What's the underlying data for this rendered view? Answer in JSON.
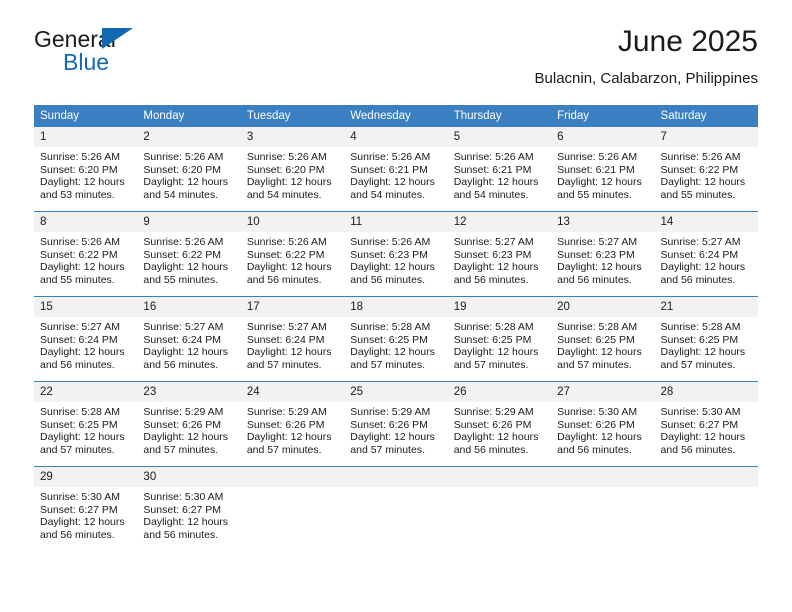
{
  "brand": {
    "name_top": "General",
    "name_bottom": "Blue",
    "triangle_icon": "triangle-icon",
    "colors": {
      "blue": "#1268b3",
      "dark": "#1b1b1b"
    }
  },
  "header": {
    "title": "June 2025",
    "subtitle": "Bulacnin, Calabarzon, Philippines"
  },
  "calendar": {
    "header_bg": "#3a7fc1",
    "daynum_bg": "#f2f2f2",
    "weekdays": [
      "Sunday",
      "Monday",
      "Tuesday",
      "Wednesday",
      "Thursday",
      "Friday",
      "Saturday"
    ],
    "weeks": [
      [
        {
          "day": "1",
          "sunrise": "Sunrise: 5:26 AM",
          "sunset": "Sunset: 6:20 PM",
          "daylight_line1": "Daylight: 12 hours",
          "daylight_line2": "and 53 minutes."
        },
        {
          "day": "2",
          "sunrise": "Sunrise: 5:26 AM",
          "sunset": "Sunset: 6:20 PM",
          "daylight_line1": "Daylight: 12 hours",
          "daylight_line2": "and 54 minutes."
        },
        {
          "day": "3",
          "sunrise": "Sunrise: 5:26 AM",
          "sunset": "Sunset: 6:20 PM",
          "daylight_line1": "Daylight: 12 hours",
          "daylight_line2": "and 54 minutes."
        },
        {
          "day": "4",
          "sunrise": "Sunrise: 5:26 AM",
          "sunset": "Sunset: 6:21 PM",
          "daylight_line1": "Daylight: 12 hours",
          "daylight_line2": "and 54 minutes."
        },
        {
          "day": "5",
          "sunrise": "Sunrise: 5:26 AM",
          "sunset": "Sunset: 6:21 PM",
          "daylight_line1": "Daylight: 12 hours",
          "daylight_line2": "and 54 minutes."
        },
        {
          "day": "6",
          "sunrise": "Sunrise: 5:26 AM",
          "sunset": "Sunset: 6:21 PM",
          "daylight_line1": "Daylight: 12 hours",
          "daylight_line2": "and 55 minutes."
        },
        {
          "day": "7",
          "sunrise": "Sunrise: 5:26 AM",
          "sunset": "Sunset: 6:22 PM",
          "daylight_line1": "Daylight: 12 hours",
          "daylight_line2": "and 55 minutes."
        }
      ],
      [
        {
          "day": "8",
          "sunrise": "Sunrise: 5:26 AM",
          "sunset": "Sunset: 6:22 PM",
          "daylight_line1": "Daylight: 12 hours",
          "daylight_line2": "and 55 minutes."
        },
        {
          "day": "9",
          "sunrise": "Sunrise: 5:26 AM",
          "sunset": "Sunset: 6:22 PM",
          "daylight_line1": "Daylight: 12 hours",
          "daylight_line2": "and 55 minutes."
        },
        {
          "day": "10",
          "sunrise": "Sunrise: 5:26 AM",
          "sunset": "Sunset: 6:22 PM",
          "daylight_line1": "Daylight: 12 hours",
          "daylight_line2": "and 56 minutes."
        },
        {
          "day": "11",
          "sunrise": "Sunrise: 5:26 AM",
          "sunset": "Sunset: 6:23 PM",
          "daylight_line1": "Daylight: 12 hours",
          "daylight_line2": "and 56 minutes."
        },
        {
          "day": "12",
          "sunrise": "Sunrise: 5:27 AM",
          "sunset": "Sunset: 6:23 PM",
          "daylight_line1": "Daylight: 12 hours",
          "daylight_line2": "and 56 minutes."
        },
        {
          "day": "13",
          "sunrise": "Sunrise: 5:27 AM",
          "sunset": "Sunset: 6:23 PM",
          "daylight_line1": "Daylight: 12 hours",
          "daylight_line2": "and 56 minutes."
        },
        {
          "day": "14",
          "sunrise": "Sunrise: 5:27 AM",
          "sunset": "Sunset: 6:24 PM",
          "daylight_line1": "Daylight: 12 hours",
          "daylight_line2": "and 56 minutes."
        }
      ],
      [
        {
          "day": "15",
          "sunrise": "Sunrise: 5:27 AM",
          "sunset": "Sunset: 6:24 PM",
          "daylight_line1": "Daylight: 12 hours",
          "daylight_line2": "and 56 minutes."
        },
        {
          "day": "16",
          "sunrise": "Sunrise: 5:27 AM",
          "sunset": "Sunset: 6:24 PM",
          "daylight_line1": "Daylight: 12 hours",
          "daylight_line2": "and 56 minutes."
        },
        {
          "day": "17",
          "sunrise": "Sunrise: 5:27 AM",
          "sunset": "Sunset: 6:24 PM",
          "daylight_line1": "Daylight: 12 hours",
          "daylight_line2": "and 57 minutes."
        },
        {
          "day": "18",
          "sunrise": "Sunrise: 5:28 AM",
          "sunset": "Sunset: 6:25 PM",
          "daylight_line1": "Daylight: 12 hours",
          "daylight_line2": "and 57 minutes."
        },
        {
          "day": "19",
          "sunrise": "Sunrise: 5:28 AM",
          "sunset": "Sunset: 6:25 PM",
          "daylight_line1": "Daylight: 12 hours",
          "daylight_line2": "and 57 minutes."
        },
        {
          "day": "20",
          "sunrise": "Sunrise: 5:28 AM",
          "sunset": "Sunset: 6:25 PM",
          "daylight_line1": "Daylight: 12 hours",
          "daylight_line2": "and 57 minutes."
        },
        {
          "day": "21",
          "sunrise": "Sunrise: 5:28 AM",
          "sunset": "Sunset: 6:25 PM",
          "daylight_line1": "Daylight: 12 hours",
          "daylight_line2": "and 57 minutes."
        }
      ],
      [
        {
          "day": "22",
          "sunrise": "Sunrise: 5:28 AM",
          "sunset": "Sunset: 6:25 PM",
          "daylight_line1": "Daylight: 12 hours",
          "daylight_line2": "and 57 minutes."
        },
        {
          "day": "23",
          "sunrise": "Sunrise: 5:29 AM",
          "sunset": "Sunset: 6:26 PM",
          "daylight_line1": "Daylight: 12 hours",
          "daylight_line2": "and 57 minutes."
        },
        {
          "day": "24",
          "sunrise": "Sunrise: 5:29 AM",
          "sunset": "Sunset: 6:26 PM",
          "daylight_line1": "Daylight: 12 hours",
          "daylight_line2": "and 57 minutes."
        },
        {
          "day": "25",
          "sunrise": "Sunrise: 5:29 AM",
          "sunset": "Sunset: 6:26 PM",
          "daylight_line1": "Daylight: 12 hours",
          "daylight_line2": "and 57 minutes."
        },
        {
          "day": "26",
          "sunrise": "Sunrise: 5:29 AM",
          "sunset": "Sunset: 6:26 PM",
          "daylight_line1": "Daylight: 12 hours",
          "daylight_line2": "and 56 minutes."
        },
        {
          "day": "27",
          "sunrise": "Sunrise: 5:30 AM",
          "sunset": "Sunset: 6:26 PM",
          "daylight_line1": "Daylight: 12 hours",
          "daylight_line2": "and 56 minutes."
        },
        {
          "day": "28",
          "sunrise": "Sunrise: 5:30 AM",
          "sunset": "Sunset: 6:27 PM",
          "daylight_line1": "Daylight: 12 hours",
          "daylight_line2": "and 56 minutes."
        }
      ],
      [
        {
          "day": "29",
          "sunrise": "Sunrise: 5:30 AM",
          "sunset": "Sunset: 6:27 PM",
          "daylight_line1": "Daylight: 12 hours",
          "daylight_line2": "and 56 minutes."
        },
        {
          "day": "30",
          "sunrise": "Sunrise: 5:30 AM",
          "sunset": "Sunset: 6:27 PM",
          "daylight_line1": "Daylight: 12 hours",
          "daylight_line2": "and 56 minutes."
        },
        {
          "day": "",
          "sunrise": "",
          "sunset": "",
          "daylight_line1": "",
          "daylight_line2": ""
        },
        {
          "day": "",
          "sunrise": "",
          "sunset": "",
          "daylight_line1": "",
          "daylight_line2": ""
        },
        {
          "day": "",
          "sunrise": "",
          "sunset": "",
          "daylight_line1": "",
          "daylight_line2": ""
        },
        {
          "day": "",
          "sunrise": "",
          "sunset": "",
          "daylight_line1": "",
          "daylight_line2": ""
        },
        {
          "day": "",
          "sunrise": "",
          "sunset": "",
          "daylight_line1": "",
          "daylight_line2": ""
        }
      ]
    ]
  }
}
